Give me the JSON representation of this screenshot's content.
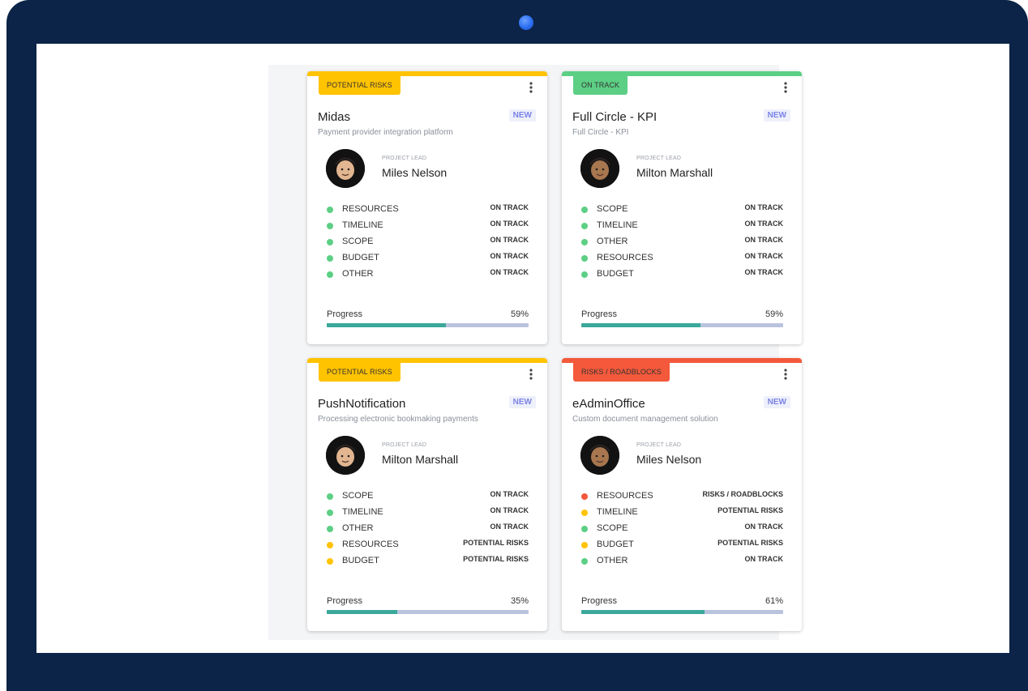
{
  "colors": {
    "on_track": "#5ccf84",
    "potential_risks": "#ffc300",
    "risks_roadblocks": "#f4593b",
    "progress_fill": "#3ba89a",
    "progress_track": "#b9c3dd",
    "laptop_frame": "#0b2447"
  },
  "cards": [
    {
      "status": "POTENTIAL RISKS",
      "status_kind": "potential_risks",
      "title": "Midas",
      "badge": "NEW",
      "subtitle": "Payment provider integration platform",
      "lead_label": "PROJECT LEAD",
      "lead_name": "Miles Nelson",
      "items": [
        {
          "label": "RESOURCES",
          "status": "ON TRACK",
          "kind": "on_track"
        },
        {
          "label": "TIMELINE",
          "status": "ON TRACK",
          "kind": "on_track"
        },
        {
          "label": "SCOPE",
          "status": "ON TRACK",
          "kind": "on_track"
        },
        {
          "label": "BUDGET",
          "status": "ON TRACK",
          "kind": "on_track"
        },
        {
          "label": "OTHER",
          "status": "ON TRACK",
          "kind": "on_track"
        }
      ],
      "progress_label": "Progress",
      "progress_text": "59%",
      "progress": 59
    },
    {
      "status": "ON TRACK",
      "status_kind": "on_track",
      "title": "Full Circle - KPI",
      "badge": "NEW",
      "subtitle": "Full Circle - KPI",
      "lead_label": "PROJECT LEAD",
      "lead_name": "Milton Marshall",
      "items": [
        {
          "label": "SCOPE",
          "status": "ON TRACK",
          "kind": "on_track"
        },
        {
          "label": "TIMELINE",
          "status": "ON TRACK",
          "kind": "on_track"
        },
        {
          "label": "OTHER",
          "status": "ON TRACK",
          "kind": "on_track"
        },
        {
          "label": "RESOURCES",
          "status": "ON TRACK",
          "kind": "on_track"
        },
        {
          "label": "BUDGET",
          "status": "ON TRACK",
          "kind": "on_track"
        }
      ],
      "progress_label": "Progress",
      "progress_text": "59%",
      "progress": 59
    },
    {
      "status": "POTENTIAL RISKS",
      "status_kind": "potential_risks",
      "title": "PushNotification",
      "badge": "NEW",
      "subtitle": "Processing electronic bookmaking payments",
      "lead_label": "PROJECT LEAD",
      "lead_name": "Milton Marshall",
      "items": [
        {
          "label": "SCOPE",
          "status": "ON TRACK",
          "kind": "on_track"
        },
        {
          "label": "TIMELINE",
          "status": "ON TRACK",
          "kind": "on_track"
        },
        {
          "label": "OTHER",
          "status": "ON TRACK",
          "kind": "on_track"
        },
        {
          "label": "RESOURCES",
          "status": "POTENTIAL RISKS",
          "kind": "potential_risks"
        },
        {
          "label": "BUDGET",
          "status": "POTENTIAL RISKS",
          "kind": "potential_risks"
        }
      ],
      "progress_label": "Progress",
      "progress_text": "35%",
      "progress": 35
    },
    {
      "status": "RISKS / ROADBLOCKS",
      "status_kind": "risks_roadblocks",
      "title": "eAdminOffice",
      "badge": "NEW",
      "subtitle": "Custom document management solution",
      "lead_label": "PROJECT LEAD",
      "lead_name": "Miles Nelson",
      "items": [
        {
          "label": "RESOURCES",
          "status": "RISKS / ROADBLOCKS",
          "kind": "risks_roadblocks"
        },
        {
          "label": "TIMELINE",
          "status": "POTENTIAL RISKS",
          "kind": "potential_risks"
        },
        {
          "label": "SCOPE",
          "status": "ON TRACK",
          "kind": "on_track"
        },
        {
          "label": "BUDGET",
          "status": "POTENTIAL RISKS",
          "kind": "potential_risks"
        },
        {
          "label": "OTHER",
          "status": "ON TRACK",
          "kind": "on_track"
        }
      ],
      "progress_label": "Progress",
      "progress_text": "61%",
      "progress": 61
    }
  ]
}
